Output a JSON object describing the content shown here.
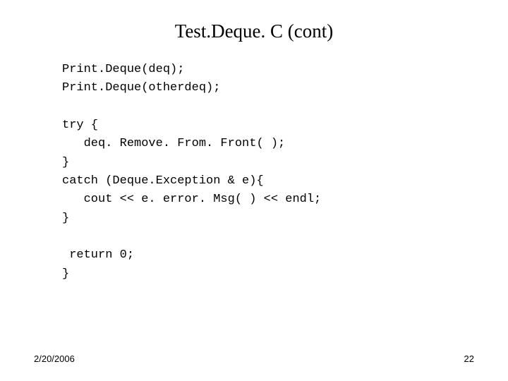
{
  "title": "Test.Deque. C (cont)",
  "code": "Print.Deque(deq);\nPrint.Deque(otherdeq);\n\ntry {\n   deq. Remove. From. Front( );\n}\ncatch (Deque.Exception & e){\n   cout << e. error. Msg( ) << endl;\n}\n\n return 0;\n}",
  "footer": {
    "date": "2/20/2006",
    "page": "22"
  }
}
